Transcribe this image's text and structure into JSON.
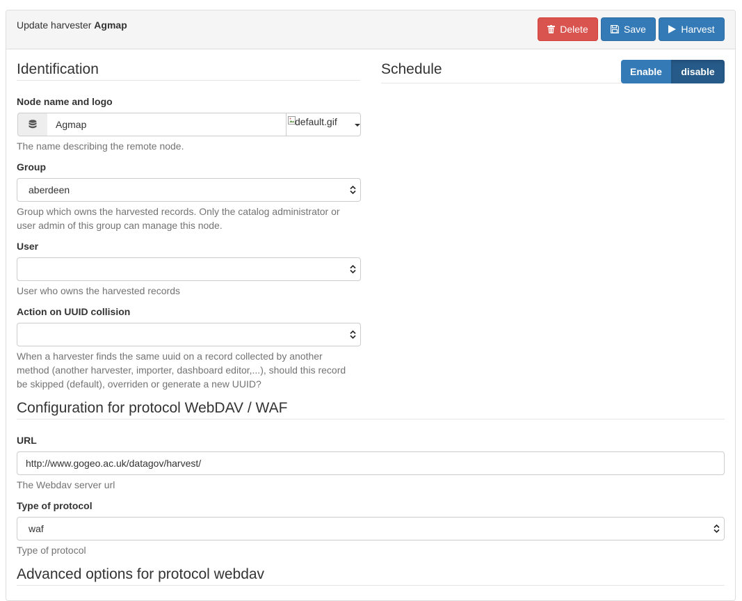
{
  "header": {
    "title_prefix": "Update harvester",
    "title_name": "Agmap",
    "buttons": {
      "delete": "Delete",
      "save": "Save",
      "harvest": "Harvest"
    }
  },
  "identification": {
    "title": "Identification",
    "node_name": {
      "label": "Node name and logo",
      "value": "Agmap",
      "logo_alt": "default.gif",
      "help": "The name describing the remote node."
    },
    "group": {
      "label": "Group",
      "selected": "aberdeen",
      "help_line1": "Group which owns the harvested records. Only the catalog administrator or",
      "help_line2": "user admin of this group can manage this node."
    },
    "user": {
      "label": "User",
      "selected": "",
      "help": "User who owns the harvested records"
    },
    "uuid_collision": {
      "label": "Action on UUID collision",
      "selected": "",
      "help_line1": "When a harvester finds the same uuid on a record collected by another",
      "help_line2": "method (another harvester, importer, dashboard editor,...), should this record",
      "help_line3": "be skipped (default), overriden or generate a new UUID?"
    }
  },
  "schedule": {
    "title": "Schedule",
    "enable_label": "Enable",
    "disable_label": "disable"
  },
  "protocol": {
    "title": "Configuration for protocol WebDAV / WAF",
    "url": {
      "label": "URL",
      "value": "http://www.gogeo.ac.uk/datagov/harvest/",
      "help": "The Webdav server url"
    },
    "type": {
      "label": "Type of protocol",
      "selected": "waf",
      "help": "Type of protocol"
    }
  },
  "advanced": {
    "title": "Advanced options for protocol webdav"
  },
  "colors": {
    "danger": "#d9534f",
    "primary": "#337ab7",
    "primary_active": "#265a88"
  },
  "icons": {
    "delete": "trash-icon",
    "save": "floppy-disk-icon",
    "harvest": "play-icon",
    "node": "database-icon"
  }
}
